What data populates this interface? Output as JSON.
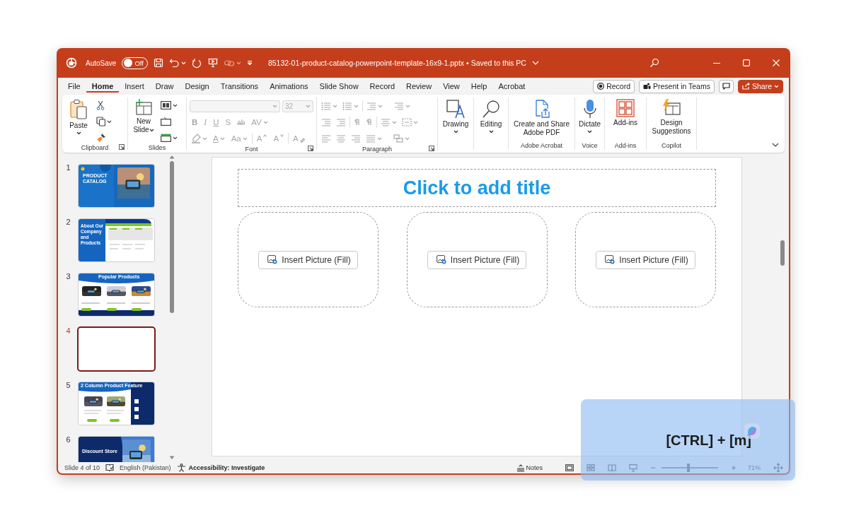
{
  "title_bar": {
    "autosave_label": "AutoSave",
    "autosave": {
      "label": "Off",
      "on": false
    },
    "title": "85132-01-product-catalog-powerpoint-template-16x9-1.pptx • Saved to this PC"
  },
  "menu_tabs": [
    {
      "label": "File",
      "selected": false
    },
    {
      "label": "Home",
      "selected": true
    },
    {
      "label": "Insert",
      "selected": false
    },
    {
      "label": "Draw",
      "selected": false
    },
    {
      "label": "Design",
      "selected": false
    },
    {
      "label": "Transitions",
      "selected": false
    },
    {
      "label": "Animations",
      "selected": false
    },
    {
      "label": "Slide Show",
      "selected": false
    },
    {
      "label": "Record",
      "selected": false
    },
    {
      "label": "Review",
      "selected": false
    },
    {
      "label": "View",
      "selected": false
    },
    {
      "label": "Help",
      "selected": false
    },
    {
      "label": "Acrobat",
      "selected": false
    }
  ],
  "header_buttons": [
    {
      "kind": "record",
      "label": "Record"
    },
    {
      "kind": "teams",
      "label": "Present in Teams"
    },
    {
      "kind": "comments"
    },
    {
      "kind": "share",
      "label": "Share"
    }
  ],
  "ribbon": {
    "groups": [
      {
        "kind": "clipboard",
        "label": "Clipboard",
        "launcher": true,
        "disabled": false,
        "button": "Paste"
      },
      {
        "kind": "slides",
        "label": "Slides",
        "launcher": false,
        "disabled": false,
        "button": "New Slide"
      },
      {
        "kind": "font",
        "label": "Font",
        "launcher": true,
        "disabled": true,
        "font_size": "32",
        "format_buttons": [
          "B",
          "I",
          "U",
          "S",
          "ab",
          "AV"
        ],
        "font_color": "A",
        "change_case": "Aa",
        "grow": "A",
        "shrink": "A",
        "clear": "A"
      },
      {
        "kind": "paragraph",
        "label": "Paragraph",
        "launcher": true,
        "disabled": true
      },
      {
        "kind": "drawing",
        "launcher": false,
        "disabled": false,
        "button": "Drawing"
      },
      {
        "kind": "editing",
        "launcher": false,
        "disabled": false,
        "button": "Editing"
      },
      {
        "kind": "acrobat",
        "label": "Adobe Acrobat",
        "launcher": false,
        "disabled": false,
        "button": "Create and Share Adobe PDF"
      },
      {
        "kind": "voice",
        "label": "Voice",
        "launcher": false,
        "disabled": false,
        "button": "Dictate"
      },
      {
        "kind": "addins",
        "label": "Add-ins",
        "launcher": false,
        "disabled": false,
        "button": "Add-ins"
      },
      {
        "kind": "copilot",
        "label": "Copilot",
        "launcher": false,
        "disabled": false,
        "button": "Design Suggestions"
      }
    ]
  },
  "slides_pane": {
    "slides": [
      {
        "number": "1",
        "selected": false,
        "kind": "cover",
        "title": "PRODUCT CATALOG"
      },
      {
        "number": "2",
        "selected": false,
        "kind": "about",
        "title": "About Our Company and Products"
      },
      {
        "number": "3",
        "selected": false,
        "kind": "products",
        "title": "Popular Products"
      },
      {
        "number": "4",
        "selected": true,
        "kind": "blank"
      },
      {
        "number": "5",
        "selected": false,
        "kind": "features",
        "title": "2 Column Product Feature"
      },
      {
        "number": "6",
        "selected": false,
        "kind": "discount",
        "title": "Discount Store"
      }
    ]
  },
  "slide": {
    "title_placeholder": "Click to add title",
    "picture_placeholders": [
      {
        "button": "Insert Picture (Fill)"
      },
      {
        "button": "Insert Picture (Fill)"
      },
      {
        "button": "Insert Picture (Fill)"
      }
    ]
  },
  "status_bar": {
    "slide_info": "Slide 4 of 10",
    "language": "English (Pakistan)",
    "accessibility": "Accessibility: Investigate",
    "notes": "Notes",
    "zoom": {
      "level": 0.48
    },
    "zoom_percent": "71%"
  },
  "shortcut_overlay": {
    "text": "[CTRL] + [m]"
  }
}
